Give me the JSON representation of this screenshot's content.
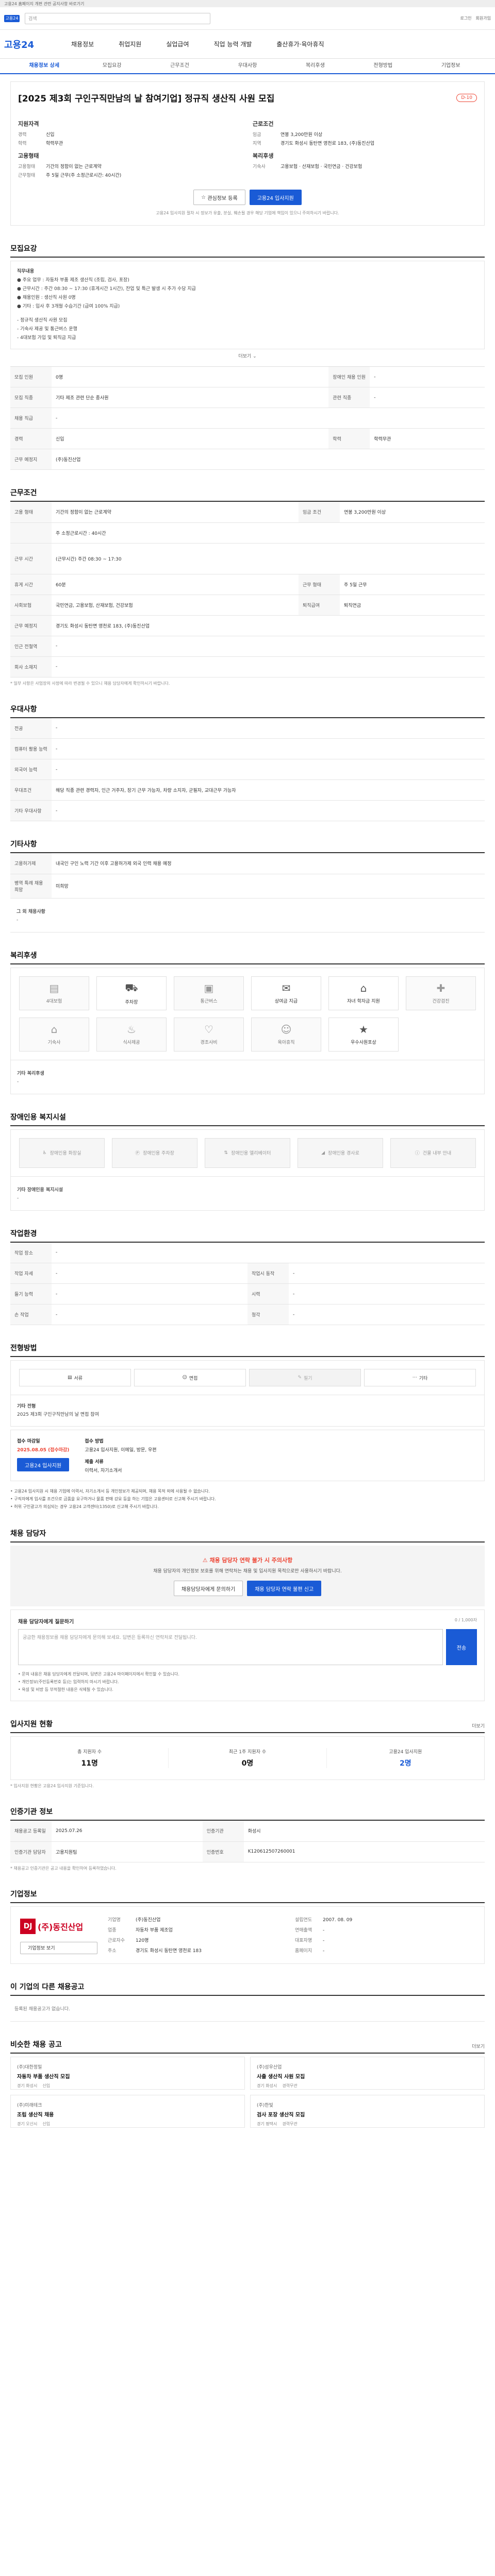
{
  "notice": "고용24 홈페이지 개편 관련 공지사항 바로가기",
  "header": {
    "logo_small": "고용24",
    "search_placeholder": "검색",
    "util": [
      "로그인",
      "회원가입"
    ],
    "brand": "고용24",
    "menu": [
      "채용정보",
      "취업지원",
      "실업급여",
      "직업 능력 개발",
      "출산휴가·육아휴직"
    ]
  },
  "tabs": [
    "채용정보 상세",
    "모집요강",
    "근무조건",
    "우대사항",
    "복리후생",
    "전형방법",
    "기업정보"
  ],
  "job": {
    "title": "[2025 제3회 구인구직만남의 날 참여기업] 정규직 생산직 사원 모집",
    "badge": "D-10",
    "col1_title": "지원자격",
    "col1": [
      {
        "k": "경력",
        "v": "신입"
      },
      {
        "k": "학력",
        "v": "학력무관"
      }
    ],
    "col1b_title": "고용형태",
    "col1b": [
      {
        "k": "고용형태",
        "v": "기간의 정함이 없는 근로계약"
      },
      {
        "k": "근무형태",
        "v": "주 5일 근무(주 소정근로시간: 40시간)"
      }
    ],
    "col2_title": "근로조건",
    "col2": [
      {
        "k": "임금",
        "v": "연봉 3,200만원 이상"
      },
      {
        "k": "지역",
        "v": "경기도 화성시 동탄면 영천로 183, (주)동진산업"
      }
    ],
    "col2b_title": "복리후생",
    "col2b": [
      {
        "k": "기숙사",
        "v": "고용보험 · 산재보험 · 국민연금 · 건강보험"
      }
    ],
    "btn_scrap": "관심정보 등록",
    "btn_apply": "고용24 입사지원",
    "fine": "고용24 입사지원 절차 시 정보가 유출, 분실, 훼손될 경우 해당 기업에 책임이 있으니 주의하시기 바랍니다."
  },
  "recruit": {
    "title": "모집요강",
    "duty_lines": [
      "직무내용",
      "● 주요 업무 : 자동차 부품 제조 생산직 (조립, 검사, 포장)",
      "● 근무시간 : 주간 08:30 ~ 17:30 (휴게시간 1시간), 잔업 및 특근 발생 시 추가 수당 지급",
      "● 채용인원 : 생산직 사원 0명",
      "● 기타 : 입사 후 3개월 수습기간 (급여 100% 지급)",
      "",
      "- 정규직 생산직 사원 모집",
      "- 기숙사 제공 및 통근버스 운행",
      "- 4대보험 가입 및 퇴직금 지급"
    ],
    "more": "더보기",
    "rows": [
      {
        "k": "모집 인원",
        "v": "0명",
        "k2": "장애인 채용 인원",
        "v2": "-"
      },
      {
        "k": "모집 직종",
        "v": "기타 제조 관련 단순 종사원",
        "k2": "관련 직종",
        "v2": "-"
      },
      {
        "k": "채용 직급",
        "v": "-",
        "k2": "",
        "v2": ""
      },
      {
        "k": "경력",
        "v": "신입",
        "k2": "학력",
        "v2": "학력무관"
      },
      {
        "k": "근무 예정지",
        "v": "(주)동진산업",
        "k2": "",
        "v2": ""
      }
    ]
  },
  "conditions": {
    "title": "근무조건",
    "rows": [
      {
        "k": "고용 형태",
        "v": "기간의 정함이 없는 근로계약",
        "k2": "임금 조건",
        "v2": "연봉 3,200만원 이상"
      },
      {
        "k": "",
        "v": "주 소정근로시간 : 40시간",
        "k2": "",
        "v2": ""
      },
      {
        "k": "근무 시간",
        "v": "(근무시간) 주간 08:30 ~ 17:30",
        "k2": "",
        "v2": ""
      },
      {
        "k": "휴게 시간",
        "v": "60분",
        "k2": "근무 형태",
        "v2": "주 5일 근무"
      },
      {
        "k": "사회보험",
        "v": "국민연금, 고용보험, 산재보험, 건강보험",
        "k2": "퇴직급여",
        "v2": "퇴직연금"
      },
      {
        "k": "근무 예정지",
        "v": "경기도 화성시 동탄면 영천로 183, (주)동진산업",
        "k2": "",
        "v2": ""
      },
      {
        "k": "인근 전철역",
        "v": "-",
        "k2": "",
        "v2": ""
      },
      {
        "k": "회사 소재지",
        "v": "-",
        "k2": "",
        "v2": ""
      }
    ],
    "note": "* 일부 사항은 사업장의 사정에 따라 변경될 수 있으니 채용 담당자에게 확인하시기 바랍니다."
  },
  "preference": {
    "title": "우대사항",
    "rows": [
      {
        "k": "전공",
        "v": "-"
      },
      {
        "k": "컴퓨터 활용 능력",
        "v": "-"
      },
      {
        "k": "외국어 능력",
        "v": "-"
      },
      {
        "k": "우대조건",
        "v": "해당 직종 관련 경력자, 인근 거주자, 장기 근무 가능자, 차량 소지자, 군필자, 교대근무 가능자"
      },
      {
        "k": "기타 우대사항",
        "v": "-"
      }
    ]
  },
  "etc": {
    "title": "기타사항",
    "rows": [
      {
        "k": "고용허가제",
        "v": "내국인 구인 노력 기간 이후 고용허가제 외국 인력 채용 예정"
      },
      {
        "k": "병역 특례 채용 희망",
        "v": "미희망"
      }
    ],
    "extra_label": "그 외 채용사항",
    "extra": "-"
  },
  "welfare": {
    "title": "복리후생",
    "items": [
      {
        "icon": "document-icon",
        "label": "4대보험",
        "on": false
      },
      {
        "icon": "car-icon",
        "label": "주차장",
        "on": true
      },
      {
        "icon": "bus-icon",
        "label": "통근버스",
        "on": false
      },
      {
        "icon": "gift-icon",
        "label": "상여금 지급",
        "on": true
      },
      {
        "icon": "graduation-icon",
        "label": "자녀 학자금 지원",
        "on": true
      },
      {
        "icon": "medical-icon",
        "label": "건강검진",
        "on": false
      },
      {
        "icon": "house-icon",
        "label": "기숙사",
        "on": false
      },
      {
        "icon": "meal-icon",
        "label": "식사제공",
        "on": false
      },
      {
        "icon": "heart-icon",
        "label": "경조사비",
        "on": false
      },
      {
        "icon": "child-icon",
        "label": "육아휴직",
        "on": false
      },
      {
        "icon": "award-icon",
        "label": "우수사원포상",
        "on": true
      }
    ],
    "etc_label": "기타 복리후생",
    "etc": "-"
  },
  "disability": {
    "title": "장애인용 복지시설",
    "items": [
      "장애인용 화장실",
      "장애인용 주차장",
      "장애인용 엘리베이터",
      "장애인용 경사로",
      "건물 내부 안내"
    ],
    "etc_label": "기타 장애인용 복지시설",
    "etc": "-"
  },
  "environment": {
    "title": "작업환경",
    "rows": [
      {
        "k": "작업 장소",
        "v": "-",
        "k2": "",
        "v2": ""
      },
      {
        "k": "작업 자세",
        "v": "-",
        "k2": "작업시 동작",
        "v2": "-"
      },
      {
        "k": "들기 능력",
        "v": "-",
        "k2": "시력",
        "v2": "-"
      },
      {
        "k": "손 작업",
        "v": "-",
        "k2": "청각",
        "v2": "-"
      }
    ]
  },
  "selection": {
    "title": "전형방법",
    "methods": [
      {
        "label": "서류",
        "on": true
      },
      {
        "label": "면접",
        "on": true
      },
      {
        "label": "필기",
        "on": false
      },
      {
        "label": "기타",
        "on": true
      }
    ],
    "etc_label": "기타 전형",
    "etc": "2025 제3회 구인구직만남의 날 면접 참여",
    "apply_date_label": "접수 마감일",
    "apply_date": "2025.08.05 (접수마감)",
    "apply_method_label": "접수 방법",
    "apply_method": "고용24 입사지원, 이메일, 방문, 우편",
    "docs_label": "제출 서류",
    "docs": "이력서, 자기소개서",
    "btn_apply": "고용24 입사지원",
    "warnings": [
      "• 고용24 입사지원 시 채용 기업에 이력서, 자기소개서 등 개인정보가 제공되며, 채용 목적 외에 사용될 수 없습니다.",
      "• 구직자에게 입사를 조건으로 금품을 요구하거나 물품 판매 강요 등을 하는 기업은 고용센터로 신고해 주시기 바랍니다.",
      "• 허위 구인광고가 의심되는 경우 고용24 고객센터(1350)로 신고해 주시기 바랍니다."
    ]
  },
  "contact": {
    "title": "채용 담당자",
    "alert_title": "채용 담당자 연락 불가 시 주의사항",
    "alert_text": "채용 담당자의 개인정보 보호를 위해 연락처는 채용 및 입사지원 목적으로만 사용하시기 바랍니다.",
    "btn1": "채용담당자에게 문의하기",
    "btn2": "채용 담당자 연락 불편 신고"
  },
  "qa": {
    "title": "채용 담당자에게 질문하기",
    "limit": "0 / 1,000자",
    "placeholder": "궁금한 채용정보를 채용 담당자에게 문의해 보세요. 답변은 등록하신 연락처로 전달됩니다.",
    "send": "전송",
    "notes": [
      "• 문의 내용은 채용 담당자에게 전달되며, 답변은 고용24 마이페이지에서 확인할 수 있습니다.",
      "• 개인정보(주민등록번호 등)는 입력하지 마시기 바랍니다.",
      "• 욕설 및 비방 등 부적절한 내용은 삭제될 수 있습니다."
    ]
  },
  "applicants": {
    "title": "입사지원 현황",
    "more": "더보기",
    "stats": [
      {
        "l": "총 지원자 수",
        "n": "11명"
      },
      {
        "l": "최근 1주 지원자 수",
        "n": "0명"
      },
      {
        "l": "고용24 입사지원",
        "n": "2명"
      }
    ],
    "note": "* 입사지원 현황은 고용24 입사지원 기준입니다."
  },
  "agency": {
    "title": "인증기관 정보",
    "rows": [
      {
        "k": "채용공고 등록일",
        "v": "2025.07.26",
        "k2": "인증기관",
        "v2": "화성시"
      },
      {
        "k": "인증기관 담당자",
        "v": "고용지원팀",
        "k2": "인증번호",
        "v2": "K120612507260001"
      }
    ],
    "note": "* 채용공고 인증기관은 공고 내용을 확인하여 등록하였습니다."
  },
  "company": {
    "title": "기업정보",
    "logo_text": "(주)동진산업",
    "logo_mark": "DJ",
    "info": [
      {
        "k": "기업명",
        "v": "(주)동진산업"
      },
      {
        "k": "설립연도",
        "v": "2007. 08. 09"
      },
      {
        "k": "업종",
        "v": "자동차 부품 제조업"
      },
      {
        "k": "연매출액",
        "v": "-"
      },
      {
        "k": "근로자수",
        "v": "120명"
      },
      {
        "k": "대표자명",
        "v": "-"
      },
      {
        "k": "주소",
        "v": "경기도 화성시 동탄면 영천로 183"
      },
      {
        "k": "홈페이지",
        "v": "-"
      }
    ],
    "btn_info": "기업정보 보기"
  },
  "same_company": {
    "title": "이 기업의 다른 채용공고",
    "empty": "등록된 채용공고가 없습니다."
  },
  "similar": {
    "title": "비슷한 채용 공고",
    "more": "더보기",
    "cards": [
      {
        "c": "(주)대한정밀",
        "t": "자동차 부품 생산직 모집",
        "m1": "경기 화성시",
        "m2": "신입"
      },
      {
        "c": "(주)성우산업",
        "t": "사출 생산직 사원 모집",
        "m1": "경기 화성시",
        "m2": "경력무관"
      },
      {
        "c": "(주)미래테크",
        "t": "조립 생산직 채용",
        "m1": "경기 오산시",
        "m2": "신입"
      },
      {
        "c": "(주)한빛",
        "t": "검사 포장 생산직 모집",
        "m1": "경기 평택시",
        "m2": "경력무관"
      }
    ]
  }
}
